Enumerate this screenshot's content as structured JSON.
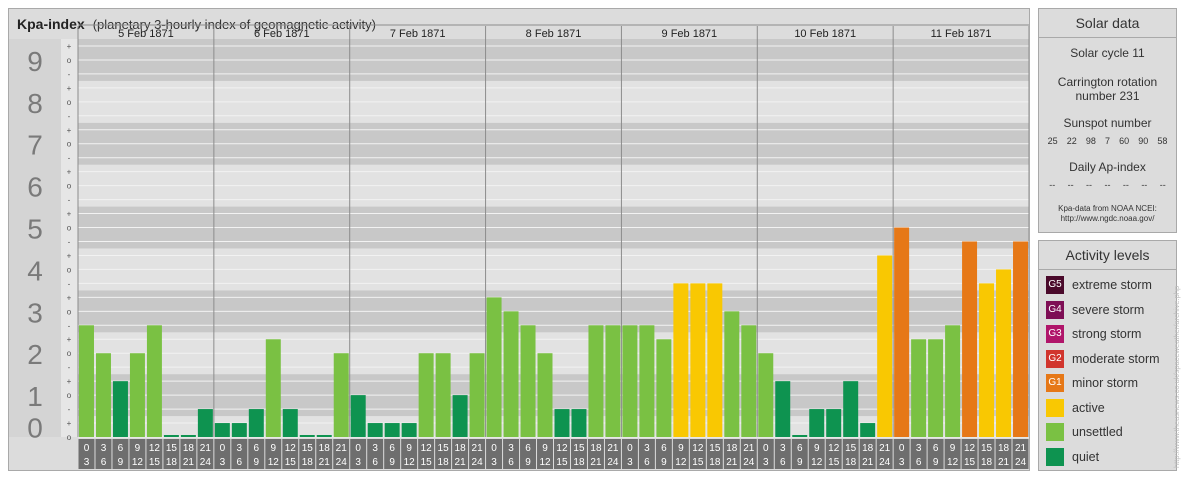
{
  "title": "Kpa-index",
  "subtitle": "(planetary 3-hourly index of geomagnetic activity)",
  "colors": {
    "quiet": "#0e9350",
    "unsettled": "#7ac143",
    "active": "#f9c802",
    "minor_storm": "#e67817",
    "moderate_storm": "#d1352d",
    "strong_storm": "#b0156a",
    "severe_storm": "#7e0e55",
    "extreme_storm": "#4a0a2b"
  },
  "chart_data": {
    "type": "bar",
    "ylim": [
      0,
      9
    ],
    "y_ticks": [
      "0",
      "1",
      "2",
      "3",
      "4",
      "5",
      "6",
      "7",
      "8",
      "9"
    ],
    "y_minor_labels": [
      "o",
      "+",
      "-"
    ],
    "dates": [
      "5 Feb 1871",
      "6 Feb 1871",
      "7 Feb 1871",
      "8 Feb 1871",
      "9 Feb 1871",
      "10 Feb 1871",
      "11 Feb 1871"
    ],
    "interval_start_hours": [
      "0",
      "3",
      "6",
      "9",
      "12",
      "15",
      "18",
      "21"
    ],
    "interval_end_hours": [
      "3",
      "6",
      "9",
      "12",
      "15",
      "18",
      "21",
      "24"
    ],
    "values": [
      2.667,
      2.0,
      1.333,
      2.0,
      2.667,
      0.0,
      0.0,
      0.667,
      0.333,
      0.333,
      0.667,
      2.333,
      0.667,
      0.0,
      0.0,
      2.0,
      1.0,
      0.333,
      0.333,
      0.333,
      2.0,
      2.0,
      1.0,
      2.0,
      3.333,
      3.0,
      2.667,
      2.0,
      0.667,
      0.667,
      2.667,
      2.667,
      2.667,
      2.667,
      2.333,
      3.667,
      3.667,
      3.667,
      3.0,
      2.667,
      2.0,
      1.333,
      0.0,
      0.667,
      0.667,
      1.333,
      0.333,
      4.333,
      5.0,
      2.333,
      2.333,
      2.667,
      4.667,
      3.667,
      4.0,
      4.667
    ]
  },
  "solar_data": {
    "title": "Solar data",
    "cycle": "Solar cycle 11",
    "carrington_line1": "Carrington rotation",
    "carrington_line2": "number 231",
    "sunspot_label": "Sunspot number",
    "sunspot_numbers": [
      "25",
      "22",
      "98",
      "7",
      "60",
      "90",
      "58"
    ],
    "ap_label": "Daily Ap-index",
    "ap_values": [
      "--",
      "--",
      "--",
      "--",
      "--",
      "--",
      "--"
    ],
    "source_line1": "Kpa-data from NOAA NCEI:",
    "source_line2": "http://www.ngdc.noaa.gov/"
  },
  "activity_levels": {
    "title": "Activity levels",
    "items": [
      {
        "badge": "G5",
        "label": "extreme storm",
        "color": "#4a0a2b"
      },
      {
        "badge": "G4",
        "label": "severe storm",
        "color": "#7e0e55"
      },
      {
        "badge": "G3",
        "label": "strong storm",
        "color": "#b0156a"
      },
      {
        "badge": "G2",
        "label": "moderate storm",
        "color": "#d1352d"
      },
      {
        "badge": "G1",
        "label": "minor storm",
        "color": "#e67817"
      },
      {
        "badge": "",
        "label": "active",
        "color": "#f9c802"
      },
      {
        "badge": "",
        "label": "unsettled",
        "color": "#7ac143"
      },
      {
        "badge": "",
        "label": "quiet",
        "color": "#0e9350"
      }
    ]
  },
  "credit": "http://www.theusnews.co.uk/spaceweather/archive.php"
}
